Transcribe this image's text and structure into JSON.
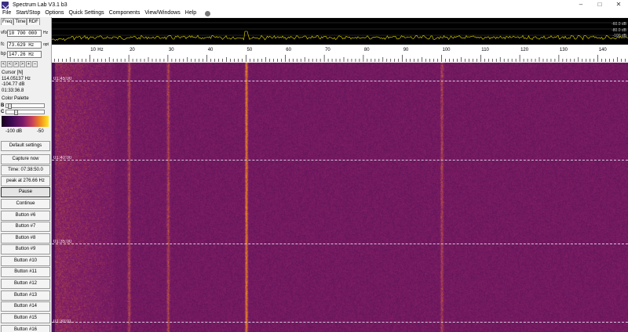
{
  "window": {
    "title": "Spectrum Lab V3.1 b3",
    "minimize": "–",
    "maximize": "□",
    "close": "✕"
  },
  "menu": [
    "File",
    "Start/Stop",
    "Options",
    "Quick Settings",
    "Components",
    "View/Windows",
    "Help"
  ],
  "left_panel": {
    "tabs": [
      "Freq",
      "Time",
      "RDF"
    ],
    "vfo": {
      "label": "vfo",
      "value": "10 700 000",
      "unit": "Hz"
    },
    "fc": {
      "label": "fc",
      "value": "73.629 Hz",
      "unit": "opt"
    },
    "bp": {
      "label": "bp",
      "value": "147.26 Hz"
    },
    "nav_buttons": [
      "<",
      "<",
      ">",
      ">",
      "+",
      "–"
    ],
    "cursor": {
      "title": "Cursor [N]",
      "freq": "114.05137 Hz",
      "level": "-104.77 dB",
      "time": "01:33:36.8"
    },
    "palette": {
      "title": "Color Palette",
      "brightness_label": "B",
      "contrast_label": "C",
      "min_label": "-100 dB",
      "max_label": "-50"
    },
    "buttons": [
      "Default settings",
      "Capture now",
      "Time:  07:38:50.0",
      "peak at 276.66 Hz",
      "Pause",
      "Continue",
      "Button #6",
      "Button #7",
      "Button #8",
      "Button #9",
      "Button #10",
      "Button #11",
      "Button #12",
      "Button #13",
      "Button #14",
      "Button #15",
      "Button #16"
    ]
  },
  "spectrum": {
    "db_labels": [
      "-60.0 dB",
      "-80.0 dB",
      "-100 dB"
    ],
    "trace_color": "#e8e000",
    "peak_freq_hz": 50
  },
  "freq_axis": {
    "unit_label": "Hz",
    "ticks": [
      "10",
      "20",
      "30",
      "40",
      "50",
      "60",
      "70",
      "80",
      "90",
      "100",
      "110",
      "120",
      "130",
      "140"
    ]
  },
  "waterfall": {
    "time_labels": [
      "01:45:00",
      "01:40:00",
      "01:35:00",
      "01:30:01"
    ],
    "lines_hz": [
      20,
      30,
      50,
      100
    ],
    "colors": {
      "base": "#5e1a68",
      "hot": "#f08a20"
    }
  }
}
